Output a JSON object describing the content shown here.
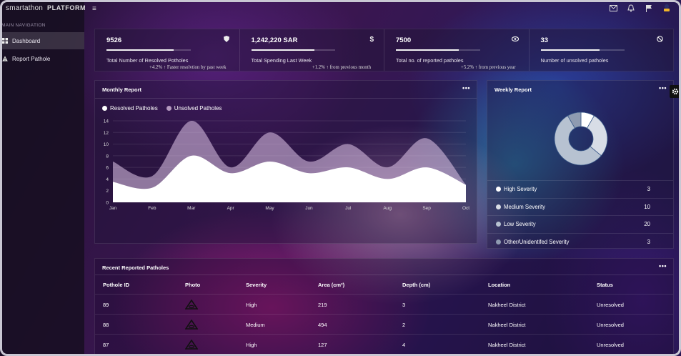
{
  "sidebar": {
    "brand": "smartathon",
    "platform": "PLATFORM",
    "heading": "MAIN NAVIGATION",
    "items": [
      {
        "label": "Dashboard",
        "icon": "dashboard-grid-icon",
        "active": true
      },
      {
        "label": "Report Pathole",
        "icon": "warning-triangle-icon",
        "active": false
      }
    ]
  },
  "topbar": {
    "menu_icon": "≡",
    "icons": [
      "mail-icon",
      "bell-icon",
      "flag-icon",
      "user-icon"
    ]
  },
  "stats": [
    {
      "value": "9526",
      "icon": "shield-icon",
      "label": "Total Number of Resolved Potholes",
      "sub": "+4.2% ↑ Faster resolvtion by past week",
      "progress": 0.8
    },
    {
      "value": "1,242,220 SAR",
      "icon": "dollar-icon",
      "label": "Total Spending Last Week",
      "sub": "+1.2% ↑ from previous month",
      "progress": 0.75
    },
    {
      "value": "7500",
      "icon": "eye-icon",
      "label": "Total no. of reported patholes",
      "sub": "+5.2% ↑ from previous year",
      "progress": 0.75
    },
    {
      "value": "33",
      "icon": "ban-icon",
      "label": "Number of unsolved patholes",
      "sub": "",
      "progress": 0.7
    }
  ],
  "monthly": {
    "title": "Monthly Report",
    "menu": "•••",
    "legend": [
      {
        "label": "Resolved Patholes",
        "color": "#ffffff"
      },
      {
        "label": "Unsolved Patholes",
        "color": "#b59ac0"
      }
    ]
  },
  "chart_data": {
    "type": "area",
    "title": "Monthly Report",
    "categories": [
      "Jan",
      "Feb",
      "Mar",
      "Apr",
      "May",
      "Jun",
      "Jul",
      "Aug",
      "Sep",
      "Oct"
    ],
    "series": [
      {
        "name": "Resolved Patholes",
        "values": [
          3.5,
          2.5,
          8,
          5,
          7,
          5,
          6,
          4,
          6,
          3
        ]
      },
      {
        "name": "Unsolved Patholes",
        "values": [
          7,
          4.5,
          14,
          6,
          12,
          7,
          10,
          6,
          11,
          3
        ]
      }
    ],
    "yticks": [
      0,
      2,
      4,
      6,
      8,
      10,
      12,
      14
    ],
    "ylim": [
      0,
      14
    ],
    "grid": true,
    "legend": "top-left"
  },
  "weekly": {
    "title": "Weekly Report",
    "menu": "•••",
    "donut": [
      {
        "label": "High Severity",
        "value": 3,
        "color": "#ffffff"
      },
      {
        "label": "Medium Severity",
        "value": 10,
        "color": "#d8dde6"
      },
      {
        "label": "Low Severity",
        "value": 20,
        "color": "#b7c2d1"
      },
      {
        "label": "Other/Unidentifed Severity",
        "value": 3,
        "color": "#8f9bb1"
      }
    ],
    "rows": [
      {
        "label": "High Severity",
        "count": "3",
        "color": "#ffffff"
      },
      {
        "label": "Medium Severity",
        "count": "10",
        "color": "#d8dde6"
      },
      {
        "label": "Low Severity",
        "count": "20",
        "color": "#b7c2d1"
      },
      {
        "label": "Other/Unidentifed Severity",
        "count": "3",
        "color": "#8f9bb1"
      }
    ]
  },
  "table": {
    "title": "Recent Reported Patholes",
    "menu": "•••",
    "headers": [
      "Pothole ID",
      "Photo",
      "Severity",
      "Area (cm²)",
      "Depth (cm)",
      "Location",
      "Status"
    ],
    "rows": [
      [
        "89",
        "pothole-icon",
        "High",
        "219",
        "3",
        "Nakheel District",
        "Unresolved"
      ],
      [
        "88",
        "pothole-icon",
        "Medium",
        "494",
        "2",
        "Nakheel District",
        "Unresolved"
      ],
      [
        "87",
        "pothole-icon",
        "High",
        "127",
        "4",
        "Nakheel District",
        "Unresolved"
      ]
    ]
  }
}
